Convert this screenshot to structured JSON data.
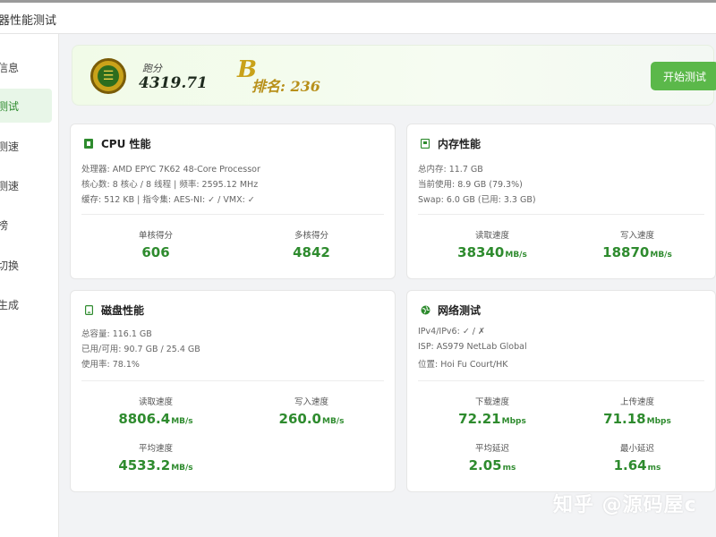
{
  "window": {
    "title": "器性能测试"
  },
  "sidebar": {
    "items": [
      {
        "label": "信息"
      },
      {
        "label": "测试",
        "active": true
      },
      {
        "label": "测速"
      },
      {
        "label": "测速"
      },
      {
        "label": "榜"
      },
      {
        "label": "切换"
      },
      {
        "label": "生成"
      }
    ]
  },
  "banner": {
    "score_label": "跑分",
    "score_value": "4319.71",
    "rank_grade": "B",
    "rank_text": "排名: 236",
    "start_button": "开始测试"
  },
  "cpu": {
    "title": "CPU 性能",
    "info": [
      "处理器: AMD EPYC 7K62 48-Core Processor",
      "核心数: 8 核心 / 8 线程 | 频率: 2595.12 MHz",
      "缓存: 512 KB | 指令集: AES-NI: ✓ / VMX: ✓"
    ],
    "metrics": [
      {
        "label": "单核得分",
        "value": "606",
        "unit": ""
      },
      {
        "label": "多核得分",
        "value": "4842",
        "unit": ""
      }
    ]
  },
  "memory": {
    "title": "内存性能",
    "info": [
      "总内存: 11.7 GB",
      "当前使用: 8.9 GB (79.3%)",
      "Swap: 6.0 GB (已用: 3.3 GB)"
    ],
    "metrics": [
      {
        "label": "读取速度",
        "value": "38340",
        "unit": "MB/s"
      },
      {
        "label": "写入速度",
        "value": "18870",
        "unit": "MB/s"
      }
    ]
  },
  "disk": {
    "title": "磁盘性能",
    "info": [
      "总容量: 116.1 GB",
      "已用/可用: 90.7 GB / 25.4 GB",
      "使用率: 78.1%"
    ],
    "metrics": [
      {
        "label": "读取速度",
        "value": "8806.4",
        "unit": "MB/s"
      },
      {
        "label": "写入速度",
        "value": "260.0",
        "unit": "MB/s"
      },
      {
        "label": "平均速度",
        "value": "4533.2",
        "unit": "MB/s"
      }
    ]
  },
  "network": {
    "title": "网络测试",
    "info": [
      "IPv4/IPv6: ✓ / ✗",
      "ISP: AS979 NetLab Global",
      "位置: Hoi Fu Court/HK"
    ],
    "metrics": [
      {
        "label": "下载速度",
        "value": "72.21",
        "unit": "Mbps"
      },
      {
        "label": "上传速度",
        "value": "71.18",
        "unit": "Mbps"
      },
      {
        "label": "平均延迟",
        "value": "2.05",
        "unit": "ms"
      },
      {
        "label": "最小延迟",
        "value": "1.64",
        "unit": "ms"
      }
    ]
  },
  "watermark": "知乎 @源码屋c",
  "colors": {
    "accent": "#2e8b2e",
    "button": "#5bb84a",
    "medal": "#c9a21a"
  },
  "icons": {
    "cpu": "cpu-icon",
    "memory": "memory-icon",
    "disk": "disk-icon",
    "network": "globe-icon",
    "medal": "medal-icon"
  }
}
